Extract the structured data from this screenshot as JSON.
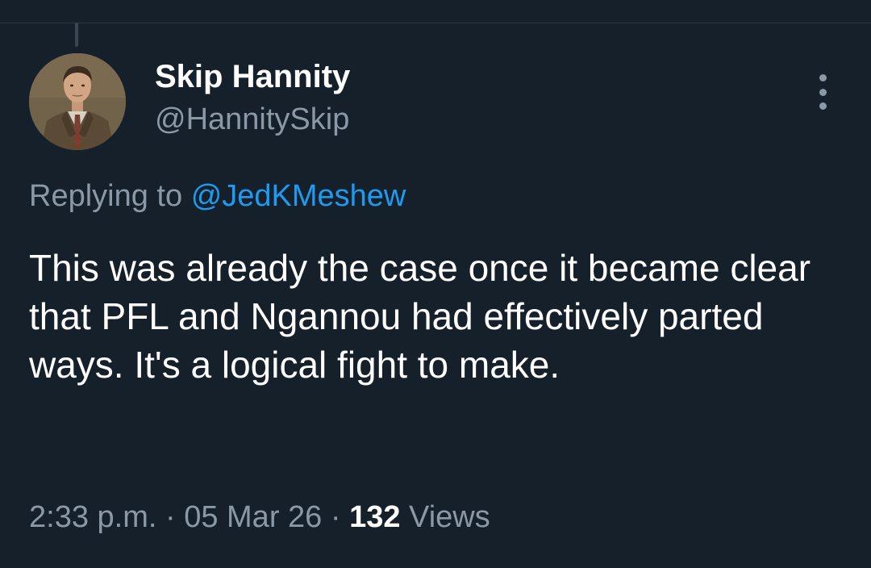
{
  "tweet": {
    "author": {
      "display_name": "Skip Hannity",
      "handle": "@HannitySkip"
    },
    "reply": {
      "prefix": "Replying to",
      "target": "@JedKMeshew"
    },
    "text": "This was already the case once it became clear that PFL and Ngannou had effectively parted ways. It's a logical fight to make.",
    "meta": {
      "time": "2:33 p.m.",
      "separator": "·",
      "date": "05 Mar 26",
      "views_count": "132",
      "views_label": "Views"
    }
  },
  "icons": {
    "more": "more-vertical-icon"
  },
  "colors": {
    "background": "#15202b",
    "primary_text": "#ffffff",
    "secondary_text": "#8b98a5",
    "link": "#1d9bf0"
  }
}
